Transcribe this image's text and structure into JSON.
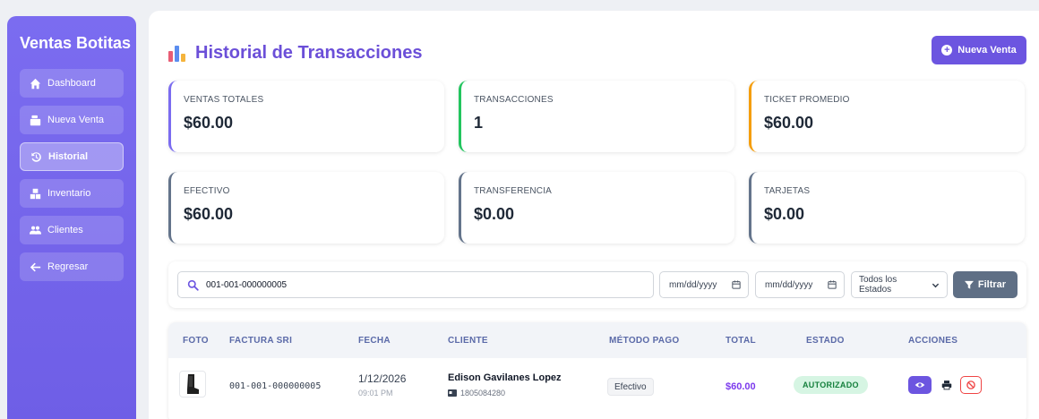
{
  "sidebar": {
    "brand": "Ventas Botitas",
    "items": [
      {
        "label": "Dashboard",
        "icon": "home-icon"
      },
      {
        "label": "Nueva Venta",
        "icon": "cash-register-icon"
      },
      {
        "label": "Historial",
        "icon": "history-icon",
        "active": true
      },
      {
        "label": "Inventario",
        "icon": "boxes-icon"
      },
      {
        "label": "Clientes",
        "icon": "users-icon"
      },
      {
        "label": "Regresar",
        "icon": "arrow-left-icon"
      }
    ]
  },
  "header": {
    "title": "Historial de Transacciones",
    "new_sale_label": "Nueva Venta"
  },
  "stats": [
    {
      "label": "VENTAS TOTALES",
      "value": "$60.00",
      "color": "#7b6cf0"
    },
    {
      "label": "TRANSACCIONES",
      "value": "1",
      "color": "#22c55e"
    },
    {
      "label": "TICKET PROMEDIO",
      "value": "$60.00",
      "color": "#f59e0b"
    },
    {
      "label": "EFECTIVO",
      "value": "$60.00",
      "color": "#64748b"
    },
    {
      "label": "TRANSFERENCIA",
      "value": "$0.00",
      "color": "#64748b"
    },
    {
      "label": "TARJETAS",
      "value": "$0.00",
      "color": "#64748b"
    }
  ],
  "filters": {
    "search_value": "001-001-000000005",
    "date_from": "mm/dd/yyyy",
    "date_to": "mm/dd/yyyy",
    "status_selected": "Todos los Estados",
    "filter_label": "Filtrar"
  },
  "table": {
    "columns": [
      "FOTO",
      "FACTURA SRI",
      "FECHA",
      "CLIENTE",
      "MÉTODO PAGO",
      "TOTAL",
      "ESTADO",
      "ACCIONES"
    ],
    "rows": [
      {
        "invoice": "001-001-000000005",
        "date": "1/12/2026",
        "time": "09:01 PM",
        "customer": "Edison Gavilanes Lopez",
        "customer_id": "1805084280",
        "method": "Efectivo",
        "total": "$60.00",
        "status": "AUTORIZADO"
      }
    ]
  },
  "colors": {
    "accent": "#6c55e0",
    "sidebar": "#7b6cf0",
    "status_ok": "#15803d",
    "danger": "#ef4444"
  }
}
